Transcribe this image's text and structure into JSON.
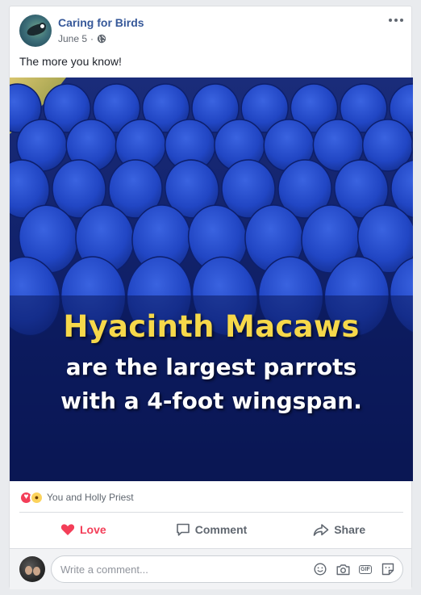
{
  "post": {
    "page_name": "Caring for Birds",
    "date": "June 5",
    "separator": "·",
    "privacy_icon": "globe-icon",
    "more_icon": "more-options-icon",
    "text": "The more you know!"
  },
  "image": {
    "caption_line1": "Hyacinth Macaws",
    "caption_line2": "are the largest parrots",
    "caption_line3": "with a 4-foot wingspan.",
    "caption_line1_color": "#f6d84a",
    "caption_text_color": "#ffffff",
    "feather_color": "#1f3fbf"
  },
  "reactions": {
    "icons": [
      "love-reaction-icon",
      "wow-reaction-icon"
    ],
    "summary": "You and Holly Priest"
  },
  "actions": {
    "love_label": "Love",
    "comment_label": "Comment",
    "share_label": "Share",
    "love_color": "#f33e58"
  },
  "comment": {
    "placeholder": "Write a comment...",
    "icons": [
      "emoji-icon",
      "camera-icon",
      "gif-icon",
      "sticker-icon"
    ],
    "gif_label": "GIF"
  },
  "colors": {
    "link": "#365899",
    "secondary_text": "#606770",
    "background": "#e9ebee"
  }
}
